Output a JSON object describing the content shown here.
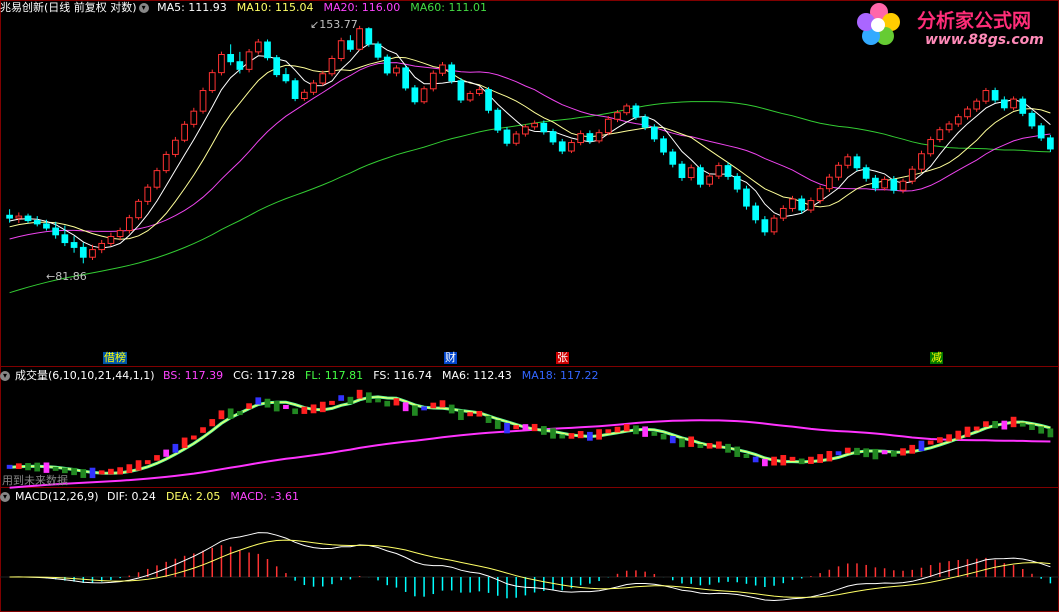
{
  "title": "兆易创新(日线 前复权 对数)",
  "main_indicators": [
    {
      "label": "MA5",
      "value": "111.93",
      "color": "#ffffff"
    },
    {
      "label": "MA10",
      "value": "115.04",
      "color": "#ffff66"
    },
    {
      "label": "MA20",
      "value": "116.00",
      "color": "#ff44ff"
    },
    {
      "label": "MA60",
      "value": "111.01",
      "color": "#44dd44"
    }
  ],
  "price_high_label": "153.77",
  "price_low_label": "81.86",
  "events": [
    {
      "text": "借榜",
      "color": "#ffff00",
      "bg": "#0055aa"
    },
    {
      "text": "财",
      "color": "#ffffff",
      "bg": "#0044cc"
    },
    {
      "text": "张",
      "color": "#ffffff",
      "bg": "#cc0000"
    },
    {
      "text": "减",
      "color": "#ffff00",
      "bg": "#007700"
    }
  ],
  "volume_panel": {
    "title": "成交量(6,10,10,21,44,1,1)",
    "indicators": [
      {
        "label": "BS",
        "value": "117.39",
        "color": "#ff44ff"
      },
      {
        "label": "CG",
        "value": "117.28",
        "color": "#ffffff"
      },
      {
        "label": "FL",
        "value": "117.81",
        "color": "#44ff44"
      },
      {
        "label": "FS",
        "value": "116.74",
        "color": "#ffffff"
      },
      {
        "label": "MA6",
        "value": "112.43",
        "color": "#ffffff"
      },
      {
        "label": "MA18",
        "value": "117.22",
        "color": "#3366ff"
      }
    ],
    "note": "用到未来数据"
  },
  "macd_panel": {
    "title": "MACD(12,26,9)",
    "indicators": [
      {
        "label": "DIF",
        "value": "0.24",
        "color": "#ffffff"
      },
      {
        "label": "DEA",
        "value": "2.05",
        "color": "#ffff66"
      },
      {
        "label": "MACD",
        "value": "-3.61",
        "color": "#ff44ff"
      }
    ]
  },
  "watermark": {
    "brand": "分析家公式网",
    "url": "www.88gs.com"
  },
  "colors": {
    "up": "#ff3232",
    "down": "#00ffff",
    "background": "#000000",
    "border": "#800000"
  },
  "chart_data": {
    "type": "candlestick",
    "title": "兆易创新(日线 前复权 对数)",
    "ohlc": [
      [
        93.0,
        94.5,
        91.2,
        92.3
      ],
      [
        92.3,
        93.7,
        91.1,
        92.8
      ],
      [
        92.8,
        93.4,
        91.1,
        91.7
      ],
      [
        91.7,
        92.8,
        90.3,
        90.9
      ],
      [
        90.9,
        91.9,
        89.3,
        89.9
      ],
      [
        89.9,
        91.4,
        87.4,
        88.3
      ],
      [
        88.3,
        90.5,
        85.7,
        86.5
      ],
      [
        86.5,
        88.0,
        84.2,
        85.4
      ],
      [
        85.4,
        86.5,
        81.86,
        83.2
      ],
      [
        83.2,
        86.0,
        82.6,
        84.9
      ],
      [
        84.9,
        87.1,
        84.1,
        86.3
      ],
      [
        86.3,
        88.8,
        85.7,
        87.9
      ],
      [
        87.9,
        90.0,
        87.0,
        89.3
      ],
      [
        89.3,
        93.1,
        88.6,
        92.4
      ],
      [
        92.4,
        97.1,
        91.9,
        96.5
      ],
      [
        96.5,
        101.0,
        95.6,
        100.2
      ],
      [
        100.2,
        105.5,
        99.6,
        104.7
      ],
      [
        104.7,
        110.2,
        104.0,
        109.3
      ],
      [
        109.3,
        114.5,
        108.5,
        113.5
      ],
      [
        113.5,
        119.4,
        112.9,
        118.4
      ],
      [
        118.4,
        123.7,
        117.4,
        122.6
      ],
      [
        122.6,
        130.5,
        121.8,
        129.5
      ],
      [
        129.5,
        136.9,
        128.7,
        135.8
      ],
      [
        135.8,
        143.6,
        134.8,
        142.5
      ],
      [
        142.5,
        146.4,
        138.5,
        139.8
      ],
      [
        139.8,
        143.5,
        135.5,
        137.0
      ],
      [
        137.0,
        144.6,
        135.9,
        143.5
      ],
      [
        143.5,
        148.5,
        142.5,
        147.3
      ],
      [
        147.3,
        148.3,
        140.3,
        141.3
      ],
      [
        141.3,
        142.3,
        134.2,
        135.1
      ],
      [
        135.1,
        137.5,
        132.0,
        132.9
      ],
      [
        132.9,
        133.8,
        125.9,
        126.8
      ],
      [
        126.8,
        129.9,
        126.0,
        128.9
      ],
      [
        128.9,
        133.2,
        128.0,
        132.1
      ],
      [
        132.1,
        136.5,
        131.2,
        135.4
      ],
      [
        135.4,
        142.1,
        134.5,
        141.0
      ],
      [
        141.0,
        149.0,
        140.0,
        147.8
      ],
      [
        147.8,
        150.0,
        143.5,
        144.5
      ],
      [
        144.5,
        153.77,
        143.9,
        152.6
      ],
      [
        152.6,
        153.2,
        145.5,
        146.5
      ],
      [
        146.5,
        147.5,
        140.5,
        141.5
      ],
      [
        141.5,
        142.5,
        134.8,
        135.7
      ],
      [
        135.7,
        138.5,
        134.5,
        137.5
      ],
      [
        137.5,
        138.4,
        129.5,
        130.4
      ],
      [
        130.4,
        131.4,
        124.8,
        125.7
      ],
      [
        125.7,
        131.0,
        125.0,
        130.1
      ],
      [
        130.1,
        136.6,
        129.2,
        135.6
      ],
      [
        135.6,
        139.7,
        134.6,
        138.6
      ],
      [
        138.6,
        139.6,
        131.9,
        132.9
      ],
      [
        132.9,
        133.9,
        125.3,
        126.3
      ],
      [
        126.3,
        129.4,
        125.6,
        128.5
      ],
      [
        128.5,
        130.8,
        127.7,
        129.8
      ],
      [
        129.8,
        130.7,
        121.9,
        122.9
      ],
      [
        122.9,
        123.7,
        115.7,
        116.6
      ],
      [
        116.6,
        117.5,
        111.7,
        112.6
      ],
      [
        112.6,
        116.3,
        111.9,
        115.4
      ],
      [
        115.4,
        118.4,
        114.6,
        117.6
      ],
      [
        117.6,
        119.6,
        116.7,
        118.7
      ],
      [
        118.7,
        119.6,
        115.2,
        116.1
      ],
      [
        116.1,
        117.0,
        112.1,
        113.0
      ],
      [
        113.0,
        113.9,
        109.4,
        110.3
      ],
      [
        110.3,
        113.7,
        109.7,
        112.8
      ],
      [
        112.8,
        116.5,
        112.0,
        115.5
      ],
      [
        115.5,
        116.5,
        112.4,
        113.3
      ],
      [
        113.3,
        116.8,
        112.6,
        115.8
      ],
      [
        115.8,
        121.0,
        115.0,
        120.0
      ],
      [
        120.0,
        123.0,
        119.1,
        122.1
      ],
      [
        122.1,
        125.1,
        121.3,
        124.3
      ],
      [
        124.3,
        125.2,
        119.8,
        120.7
      ],
      [
        120.7,
        121.6,
        116.6,
        117.5
      ],
      [
        117.5,
        118.4,
        113.0,
        113.9
      ],
      [
        113.9,
        114.8,
        109.1,
        110.0
      ],
      [
        110.0,
        110.9,
        105.6,
        106.5
      ],
      [
        106.5,
        107.4,
        101.9,
        102.8
      ],
      [
        102.8,
        106.4,
        102.0,
        105.5
      ],
      [
        105.5,
        106.4,
        100.1,
        101.0
      ],
      [
        101.0,
        104.0,
        100.3,
        103.2
      ],
      [
        103.2,
        107.0,
        102.4,
        106.1
      ],
      [
        106.1,
        107.0,
        102.2,
        103.1
      ],
      [
        103.1,
        104.0,
        98.8,
        99.7
      ],
      [
        99.7,
        100.6,
        94.4,
        95.3
      ],
      [
        95.3,
        96.2,
        91.0,
        91.9
      ],
      [
        91.9,
        92.8,
        88.1,
        89.0
      ],
      [
        89.0,
        93.1,
        88.3,
        92.3
      ],
      [
        92.3,
        95.5,
        91.6,
        94.7
      ],
      [
        94.7,
        97.9,
        93.9,
        97.1
      ],
      [
        97.1,
        98.0,
        93.4,
        94.3
      ],
      [
        94.3,
        97.5,
        93.6,
        96.7
      ],
      [
        96.7,
        100.6,
        95.9,
        99.8
      ],
      [
        99.8,
        103.8,
        98.9,
        102.9
      ],
      [
        102.9,
        107.1,
        102.0,
        106.2
      ],
      [
        106.2,
        109.5,
        105.3,
        108.6
      ],
      [
        108.6,
        109.5,
        104.6,
        105.5
      ],
      [
        105.5,
        106.4,
        101.7,
        102.6
      ],
      [
        102.6,
        103.5,
        99.1,
        100.0
      ],
      [
        100.0,
        103.1,
        99.3,
        102.3
      ],
      [
        102.3,
        103.2,
        98.5,
        99.4
      ],
      [
        99.4,
        102.5,
        98.6,
        101.8
      ],
      [
        101.8,
        106.0,
        101.0,
        105.1
      ],
      [
        105.1,
        110.4,
        104.3,
        109.5
      ],
      [
        109.5,
        114.6,
        108.7,
        113.7
      ],
      [
        113.7,
        117.6,
        112.9,
        116.7
      ],
      [
        116.7,
        119.4,
        115.8,
        118.5
      ],
      [
        118.5,
        121.7,
        117.6,
        120.8
      ],
      [
        120.8,
        124.2,
        119.9,
        123.3
      ],
      [
        123.3,
        126.8,
        122.4,
        125.9
      ],
      [
        125.9,
        130.4,
        125.0,
        129.5
      ],
      [
        129.5,
        130.5,
        125.4,
        126.3
      ],
      [
        126.3,
        127.5,
        122.8,
        123.7
      ],
      [
        123.7,
        127.5,
        122.9,
        126.6
      ],
      [
        126.6,
        127.5,
        121.0,
        121.9
      ],
      [
        121.9,
        122.8,
        117.0,
        117.9
      ],
      [
        117.9,
        118.8,
        113.3,
        114.2
      ],
      [
        114.2,
        115.1,
        110.0,
        110.9
      ]
    ],
    "ma": {
      "MA5": 111.93,
      "MA10": 115.04,
      "MA20": 116.0,
      "MA60": 111.01
    },
    "annotations": [
      {
        "text": "153.77"
      },
      {
        "text": "81.86"
      }
    ],
    "volume_ma": {
      "BS": 117.39,
      "CG": 117.28,
      "FL": 117.81,
      "FS": 116.74,
      "MA6": 112.43,
      "MA18": 117.22
    },
    "macd": {
      "DIF": 0.24,
      "DEA": 2.05,
      "MACD": -3.61
    }
  }
}
